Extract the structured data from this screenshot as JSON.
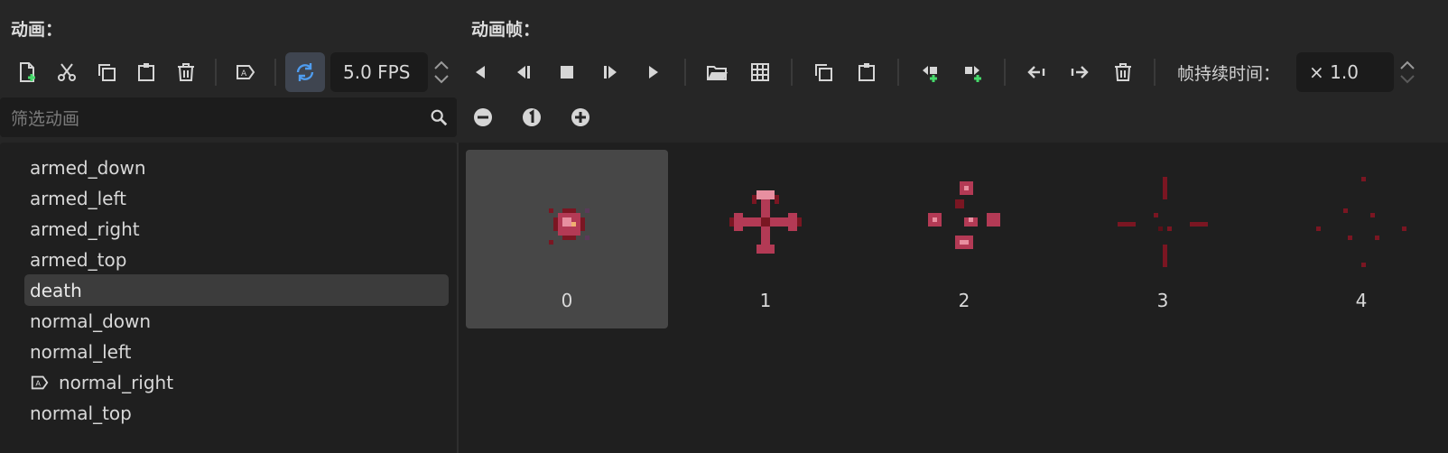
{
  "animations_panel": {
    "title": "动画：",
    "fps_value": "5.0 FPS",
    "search_placeholder": "筛选动画",
    "items": [
      {
        "label": "armed_down"
      },
      {
        "label": "armed_left"
      },
      {
        "label": "armed_right"
      },
      {
        "label": "armed_top"
      },
      {
        "label": "death",
        "selected": true
      },
      {
        "label": "normal_down"
      },
      {
        "label": "normal_left"
      },
      {
        "label": "normal_right",
        "autoplay": true
      },
      {
        "label": "normal_top"
      }
    ]
  },
  "frames_panel": {
    "title": "动画帧：",
    "duration_label": "帧持续时间：",
    "duration_value": "× 1.0",
    "frames": [
      {
        "index": "0",
        "selected": true
      },
      {
        "index": "1"
      },
      {
        "index": "2"
      },
      {
        "index": "3"
      },
      {
        "index": "4"
      }
    ]
  },
  "colors": {
    "accent_loop": "#4f9df0",
    "add_green": "#45d96a",
    "sprite_dark": "#7a1622",
    "sprite_mid": "#b33a55",
    "sprite_light": "#e88fa0"
  },
  "icons": {
    "left_toolbar": [
      "new-animation-icon",
      "cut-icon",
      "duplicate-icon",
      "paste-icon",
      "delete-icon",
      "autoplay-icon",
      "loop-icon"
    ],
    "right_toolbar": [
      "play-backwards-icon",
      "play-backwards-from-end-icon",
      "stop-icon",
      "play-from-start-icon",
      "play-icon",
      "load-frames-icon",
      "spritesheet-icon",
      "copy-frame-icon",
      "paste-frame-icon",
      "insert-before-icon",
      "insert-after-icon",
      "move-left-icon",
      "move-right-icon",
      "delete-frame-icon"
    ],
    "zoom": [
      "zoom-out-icon",
      "zoom-reset-icon",
      "zoom-in-icon"
    ]
  }
}
